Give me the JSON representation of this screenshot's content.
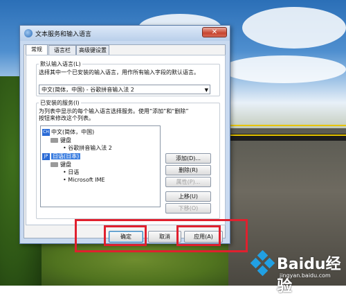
{
  "window": {
    "title": "文本服务和输入语言",
    "close_glyph": "✕"
  },
  "tabs": [
    {
      "label": "常规"
    },
    {
      "label": "语言栏"
    },
    {
      "label": "高级键设置"
    }
  ],
  "default_language": {
    "group_label": "默认输入语言(L)",
    "description": "选择其中一个已安装的输入语言，用作所有输入字段的默认语言。",
    "selected": "中文(简体，中国) - 谷歌拼音输入法 2"
  },
  "installed_services": {
    "group_label": "已安装的服务(I)",
    "description_line1": "为列表中显示的每个输入语言选择服务。使用“添加”和“删除”",
    "description_line2": "按钮来修改这个列表。",
    "tree": {
      "lang1": {
        "badge": "CH",
        "name": "中文(简体，中国)",
        "group": "键盘",
        "item": "谷歌拼音输入法 2"
      },
      "lang2": {
        "badge": "JP",
        "name": "日语(日本)",
        "group": "键盘",
        "items": [
          "日语",
          "Microsoft IME"
        ]
      }
    }
  },
  "side_buttons": {
    "add": "添加(D)...",
    "remove": "删除(R)",
    "properties": "属性(P)...",
    "move_up": "上移(U)",
    "move_down": "下移(O)"
  },
  "bottom_buttons": {
    "ok": "确定",
    "cancel": "取消",
    "apply": "应用(A)"
  },
  "watermark": {
    "brand": "Baidu经验",
    "url": "jingyan.baidu.com"
  },
  "colors": {
    "highlight_box": "#e0202e",
    "selection": "#3d7fe0"
  }
}
